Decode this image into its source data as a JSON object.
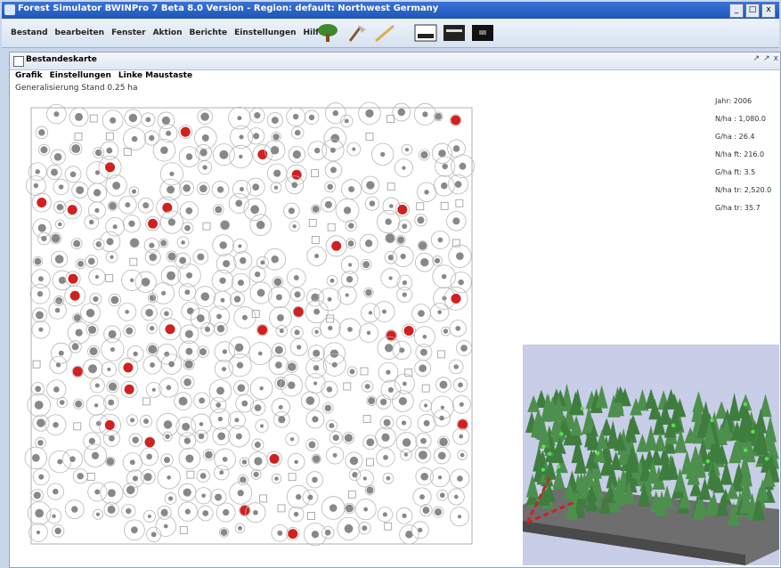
{
  "window": {
    "title": "Forest Simulator BWINPro 7 Beta 8.0 Version - Region: default: Northwest Germany",
    "controls": [
      "_",
      "□",
      "x"
    ]
  },
  "menubar": {
    "items": [
      "Bestand",
      "bearbeiten",
      "Fenster",
      "Aktion",
      "Berichte",
      "Einstellungen",
      "Hilfe"
    ]
  },
  "toolbar": {
    "tools": [
      "tree-icon",
      "axe-icon",
      "stick-icon",
      "stand-view-icon",
      "chart-view-icon",
      "3d-view-icon"
    ]
  },
  "inner_window": {
    "title": "Bestandeskarte",
    "controls": [
      "↗",
      "↗",
      "x"
    ],
    "menu": [
      "Grafik",
      "Einstellungen",
      "Linke Maustaste"
    ],
    "status": "Generalisierung Stand 0.25 ha"
  },
  "stats": {
    "lines": [
      "Jahr: 2006",
      "N/ha : 1,080.0",
      "G/ha : 26.4",
      "N/ha ft: 216.0",
      "G/ha ft: 3.5",
      "N/ha tr: 2,520.0",
      "G/ha tr: 35.7"
    ]
  },
  "map": {
    "tree_color": "#888888",
    "selected_color": "#d22020",
    "ring_color": "#b8b8b8",
    "border_color": "#b0b0b0"
  },
  "view3d": {
    "sky_color": "#c8cde8",
    "tree_color": "#3f7d3f",
    "ground_color": "#6e6e6e",
    "marker_color": "#cc2222"
  }
}
